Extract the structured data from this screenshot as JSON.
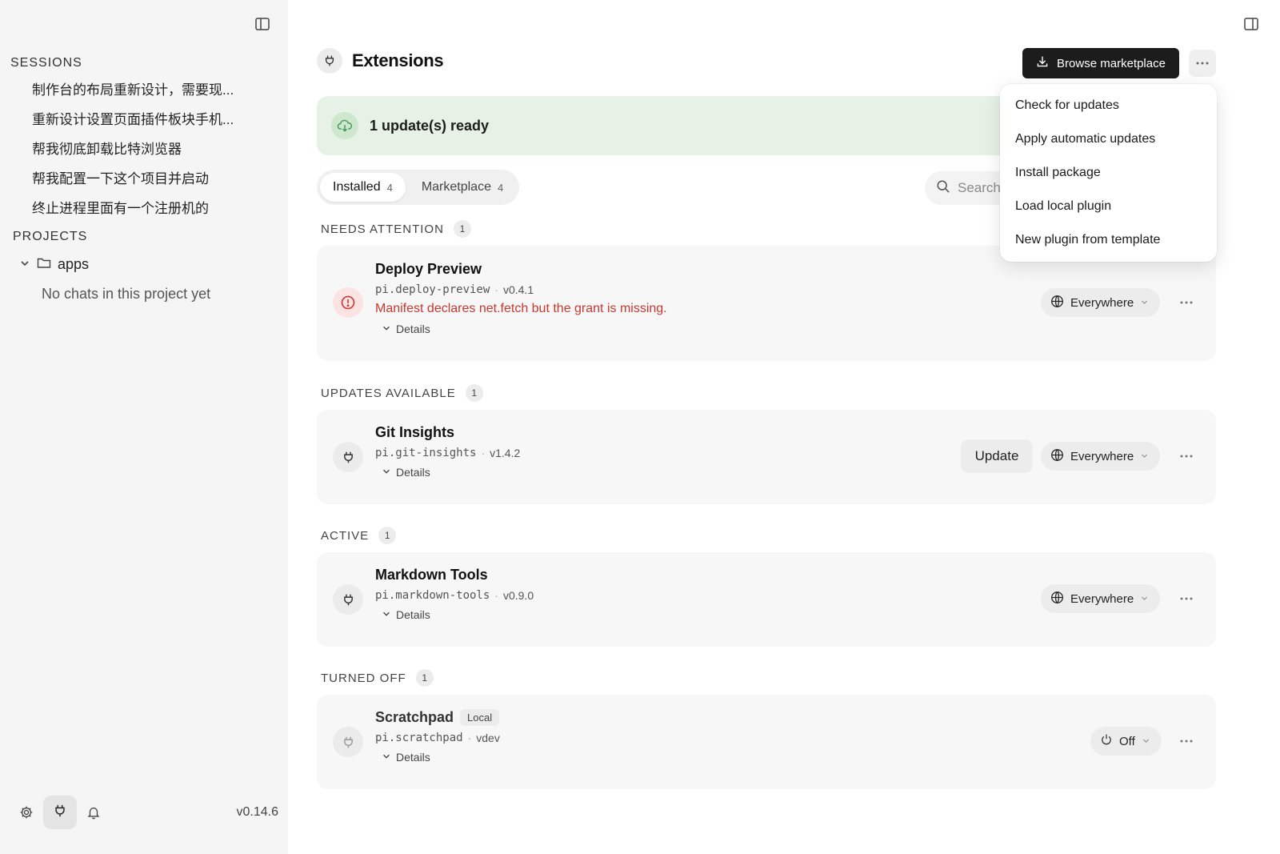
{
  "sidebar": {
    "sessions_title": "SESSIONS",
    "sessions": [
      "制作台的布局重新设计，需要现...",
      "重新设计设置页面插件板块手机...",
      "帮我彻底卸载比特浏览器",
      "帮我配置一下这个项目并启动",
      "终止进程里面有一个注册机的"
    ],
    "projects_title": "PROJECTS",
    "project": {
      "name": "apps",
      "empty_text": "No chats in this project yet"
    },
    "version": "v0.14.6"
  },
  "main": {
    "title": "Extensions",
    "browse_label": "Browse marketplace",
    "banner_text": "1 update(s) ready",
    "tabs": [
      {
        "label": "Installed",
        "count": "4",
        "active": true
      },
      {
        "label": "Marketplace",
        "count": "4",
        "active": false
      }
    ],
    "search_placeholder": "Search"
  },
  "sections": {
    "needs_attention": {
      "label": "NEEDS ATTENTION",
      "count": "1"
    },
    "updates_available": {
      "label": "UPDATES AVAILABLE",
      "count": "1"
    },
    "active": {
      "label": "ACTIVE",
      "count": "1"
    },
    "turned_off": {
      "label": "TURNED OFF",
      "count": "1"
    }
  },
  "extensions": {
    "deploy": {
      "name": "Deploy Preview",
      "id": "pi.deploy-preview",
      "version": "v0.4.1",
      "error": "Manifest declares net.fetch but the grant is missing.",
      "details": "Details",
      "scope": "Everywhere"
    },
    "git": {
      "name": "Git Insights",
      "id": "pi.git-insights",
      "version": "v1.4.2",
      "details": "Details",
      "update_label": "Update",
      "scope": "Everywhere"
    },
    "markdown": {
      "name": "Markdown Tools",
      "id": "pi.markdown-tools",
      "version": "v0.9.0",
      "details": "Details",
      "scope": "Everywhere"
    },
    "scratchpad": {
      "name": "Scratchpad",
      "badge": "Local",
      "id": "pi.scratchpad",
      "version": "vdev",
      "details": "Details",
      "scope": "Off"
    }
  },
  "menu": {
    "items": [
      "Check for updates",
      "Apply automatic updates",
      "Install package",
      "Load local plugin",
      "New plugin from template"
    ]
  },
  "colors": {
    "accent_dark": "#1c1c1c",
    "error_red": "#c8382f",
    "banner_green": "#e6f2e6",
    "icon_green": "#3d9a52"
  },
  "icons": [
    "sidebar-toggle-icon",
    "plug-icon",
    "download-icon",
    "more-icon",
    "cloud-download-icon",
    "search-icon",
    "alert-circle-icon",
    "globe-icon",
    "power-icon",
    "chevron-down-icon",
    "folder-icon",
    "gear-icon",
    "bell-icon"
  ]
}
